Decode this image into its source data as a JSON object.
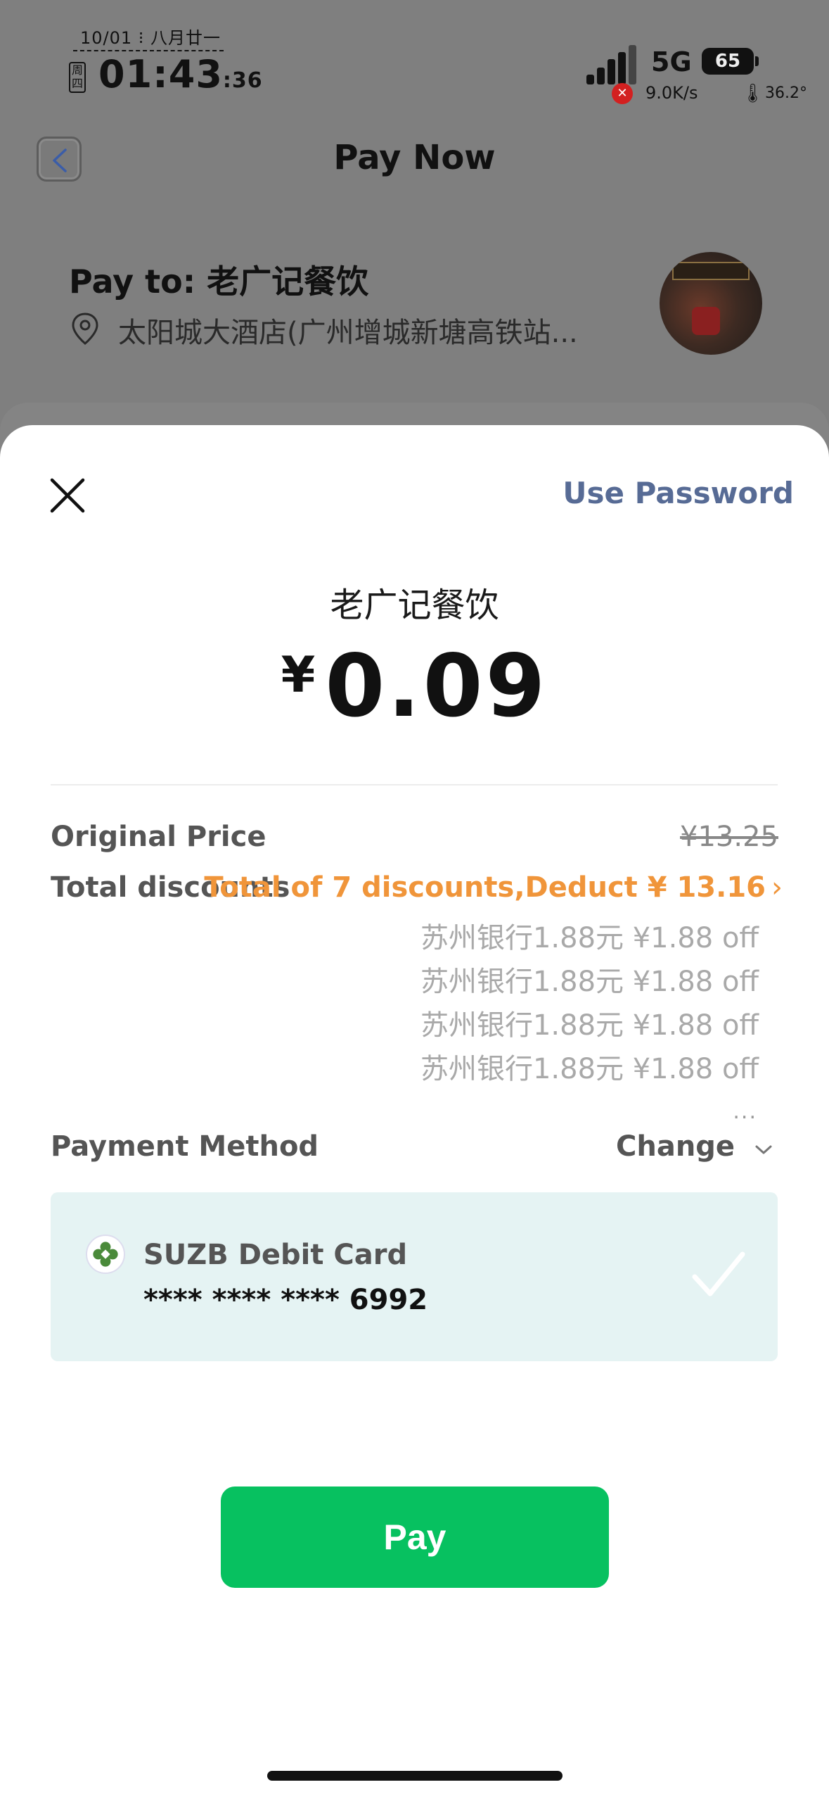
{
  "status_bar": {
    "date": "10/01 ⁝ 八月廿一",
    "weekday": "周四",
    "time_hm": "01:43",
    "time_s": ":36",
    "network": "5G",
    "battery": "65",
    "net_speed": "9.0K/s",
    "temperature": "36.2°"
  },
  "header": {
    "title": "Pay Now"
  },
  "merchant_info": {
    "pay_to": "Pay to: 老广记餐饮",
    "address": "太阳城大酒店(广州增城新塘高铁站..."
  },
  "sheet": {
    "use_password": "Use Password",
    "merchant": "老广记餐饮",
    "currency": "¥",
    "amount": "0.09",
    "original_price_label": "Original Price",
    "original_price": "¥13.25",
    "total_discounts_label": "Total discounts",
    "discount_summary": "Total of 7 discounts,Deduct ¥ 13.16",
    "discounts": [
      "苏州银行1.88元 ¥1.88 off",
      "苏州银行1.88元 ¥1.88 off",
      "苏州银行1.88元 ¥1.88 off",
      "苏州银行1.88元 ¥1.88 off"
    ],
    "more": "...",
    "payment_method_label": "Payment Method",
    "change_label": "Change",
    "card": {
      "name": "SUZB Debit Card",
      "number": "**** **** **** 6992"
    },
    "pay_button": "Pay"
  },
  "colors": {
    "accent_link": "#576b95",
    "discount_orange": "#f0953a",
    "pay_green": "#07c160",
    "card_bg": "#e5f3f3"
  },
  "icons": [
    "back-arrow-icon",
    "location-pin-icon",
    "close-icon",
    "chevron-right-icon",
    "chevron-down-icon",
    "bank-logo-icon",
    "checkmark-icon"
  ]
}
